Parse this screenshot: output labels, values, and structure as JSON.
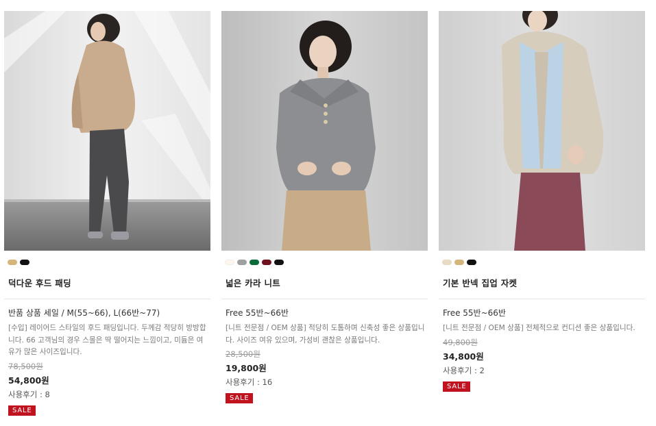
{
  "products": [
    {
      "image_alt": "Woman in beige hooded quilted padding jacket and grey wide jeans",
      "swatches": [
        "#d4b67a",
        "#111111"
      ],
      "name": "덕다운 후드 패딩",
      "size": "반품 상품 세일 / M(55~66), L(66반~77)",
      "description": "[수입] 레이어드 스타일의 후드 패딩입니다. 두께감 적당히 방방합니다. 66 고객님의 경우 스몰은 딱 떨어지는 느낌이고, 미듐은 여유가 많은 사이즈입니다.",
      "old_price": "78,500원",
      "price": "54,800원",
      "reviews": "사용후기 : 8",
      "badge": "SALE"
    },
    {
      "image_alt": "Woman in grey collared rib knit sweater and beige pants",
      "swatches": [
        "#fff7ee",
        "#a0a0a0",
        "#0d6b3a",
        "#6e1220",
        "#111111"
      ],
      "name": "넓은 카라 니트",
      "size": "Free 55반~66반",
      "description": "[니트 전문점 / OEM 상품] 적당히 도톰하며 신축성 좋은 상품입니다. 사이즈 여유 있으며, 가성비 괜찮은 상품입니다.",
      "old_price": "28,500원",
      "price": "19,800원",
      "reviews": "사용후기 : 16",
      "badge": "SALE"
    },
    {
      "image_alt": "Woman in oatmeal half-neck zip-up knit jacket and burgundy pants",
      "swatches": [
        "#e8dcc6",
        "#d4b67a",
        "#111111"
      ],
      "name": "기본 반넥 집업 자켓",
      "size": "Free 55반~66반",
      "description": "[니트 전문점 / OEM 상품] 전체적으로 컨디션 좋은 상품입니다.",
      "old_price": "49,800원",
      "price": "34,800원",
      "reviews": "사용후기 : 2",
      "badge": "SALE"
    }
  ]
}
